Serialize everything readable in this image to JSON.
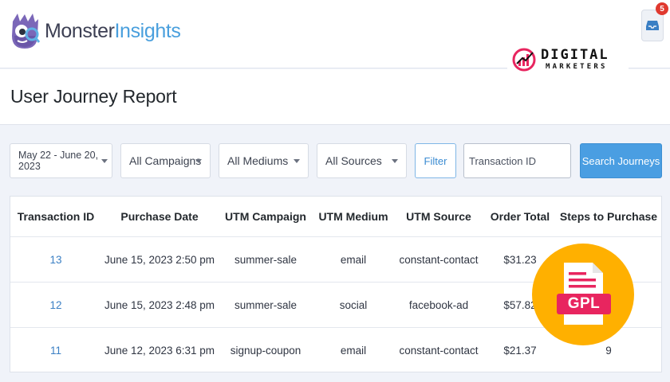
{
  "header": {
    "logo_part1": "Monster",
    "logo_part2": "Insights",
    "notification_count": "5"
  },
  "watermark": {
    "line1": "DIGITAL",
    "line2": "MARKETERS"
  },
  "page": {
    "title": "User Journey Report"
  },
  "filters": {
    "date_range": "May 22 - June 20, 2023",
    "campaigns": "All Campaigns",
    "mediums": "All Mediums",
    "sources": "All Sources",
    "filter_button": "Filter",
    "transaction_placeholder": "Transaction ID",
    "search_button": "Search Journeys"
  },
  "table": {
    "columns": [
      "Transaction ID",
      "Purchase Date",
      "UTM Campaign",
      "UTM Medium",
      "UTM Source",
      "Order Total",
      "Steps to Purchase"
    ],
    "rows": [
      {
        "id": "13",
        "date": "June 15, 2023 2:50 pm",
        "campaign": "summer-sale",
        "medium": "email",
        "source": "constant-contact",
        "total": "$31.23",
        "steps": ""
      },
      {
        "id": "12",
        "date": "June 15, 2023 2:48 pm",
        "campaign": "summer-sale",
        "medium": "social",
        "source": "facebook-ad",
        "total": "$57.82",
        "steps": ""
      },
      {
        "id": "11",
        "date": "June 12, 2023 6:31 pm",
        "campaign": "signup-coupon",
        "medium": "email",
        "source": "constant-contact",
        "total": "$21.37",
        "steps": "9"
      }
    ]
  },
  "badge": {
    "label": "GPL"
  },
  "colors": {
    "accent_blue": "#4a9ee2",
    "badge_orange": "#ffb000",
    "badge_pink": "#e8255f",
    "notification_red": "#e0392f"
  }
}
